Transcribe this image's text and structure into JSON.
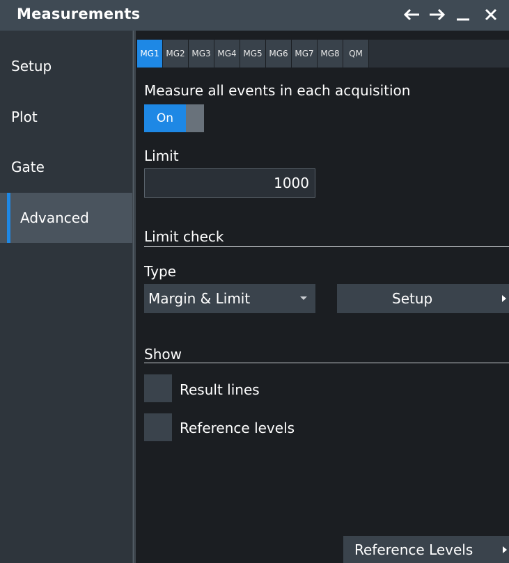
{
  "window": {
    "title": "Measurements",
    "controls": [
      "back-arrow",
      "forward-arrow",
      "minimize",
      "close"
    ]
  },
  "sidebar": {
    "items": [
      {
        "label": "Setup",
        "active": false
      },
      {
        "label": "Plot",
        "active": false
      },
      {
        "label": "Gate",
        "active": false
      },
      {
        "label": "Advanced",
        "active": true
      }
    ]
  },
  "tabs": [
    "MG1",
    "MG2",
    "MG3",
    "MG4",
    "MG5",
    "MG6",
    "MG7",
    "MG8",
    "QM"
  ],
  "active_tab": "MG1",
  "main": {
    "measure_all_label": "Measure all events in each acquisition",
    "toggle_state": "On",
    "limit_label": "Limit",
    "limit_value": "1000",
    "limit_check_heading": "Limit check",
    "type_label": "Type",
    "type_value": "Margin & Limit",
    "setup_button": "Setup",
    "show_heading": "Show",
    "result_lines_label": "Result lines",
    "reference_levels_label": "Reference levels",
    "reference_levels_button": "Reference Levels"
  },
  "colors": {
    "accent": "#1e88e5",
    "titlebar": "#3f4a54",
    "sidebar": "#2e353c",
    "background": "#1b1e22"
  }
}
